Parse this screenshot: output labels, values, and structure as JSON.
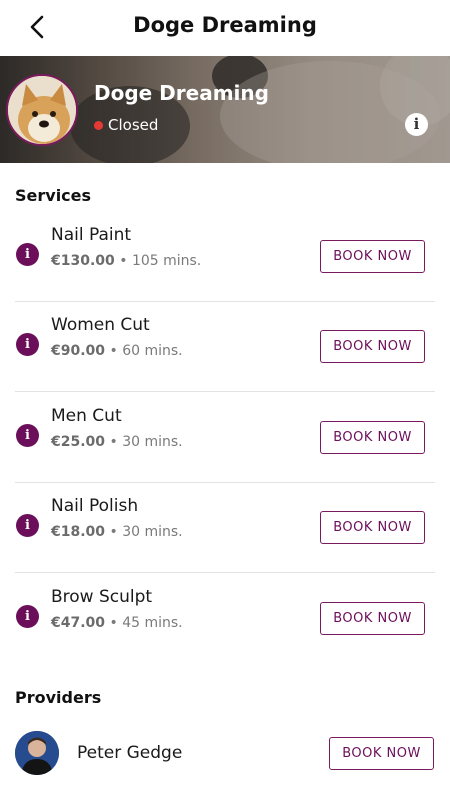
{
  "header": {
    "title": "Doge Dreaming",
    "back_icon": "chevron-left-icon"
  },
  "shop": {
    "name": "Doge Dreaming",
    "status": "Closed",
    "status_color": "#e53935",
    "info_icon": "info-icon"
  },
  "services": {
    "title": "Services",
    "items": [
      {
        "name": "Nail Paint",
        "price": "€130.00",
        "separator": "•",
        "duration": "105 mins.",
        "button": "BOOK NOW"
      },
      {
        "name": "Women Cut",
        "price": "€90.00",
        "separator": "•",
        "duration": "60 mins.",
        "button": "BOOK NOW"
      },
      {
        "name": "Men Cut",
        "price": "€25.00",
        "separator": "•",
        "duration": "30 mins.",
        "button": "BOOK NOW"
      },
      {
        "name": "Nail Polish",
        "price": "€18.00",
        "separator": "•",
        "duration": "30 mins.",
        "button": "BOOK NOW"
      },
      {
        "name": "Brow Sculpt",
        "price": "€47.00",
        "separator": "•",
        "duration": "45 mins.",
        "button": "BOOK NOW"
      }
    ]
  },
  "providers": {
    "title": "Providers",
    "items": [
      {
        "name": "Peter Gedge",
        "button": "BOOK NOW"
      }
    ]
  },
  "theme": {
    "accent": "#6c0f5a"
  }
}
